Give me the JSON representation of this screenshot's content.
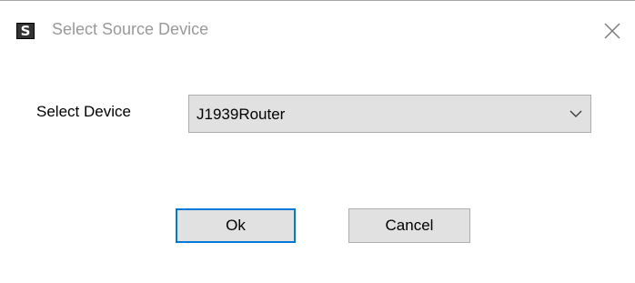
{
  "window": {
    "title": "Select Source Device",
    "app_icon_glyph": "S",
    "icons": {
      "app": "app-logo-icon",
      "close": "close-icon",
      "dropdown": "chevron-down-icon"
    }
  },
  "form": {
    "device_label": "Select Device",
    "device_select": {
      "selected": "J1939Router"
    }
  },
  "buttons": {
    "ok_label": "Ok",
    "cancel_label": "Cancel"
  },
  "colors": {
    "focus_border": "#0078d7",
    "button_face": "#e1e1e1",
    "title_text": "#999999"
  }
}
